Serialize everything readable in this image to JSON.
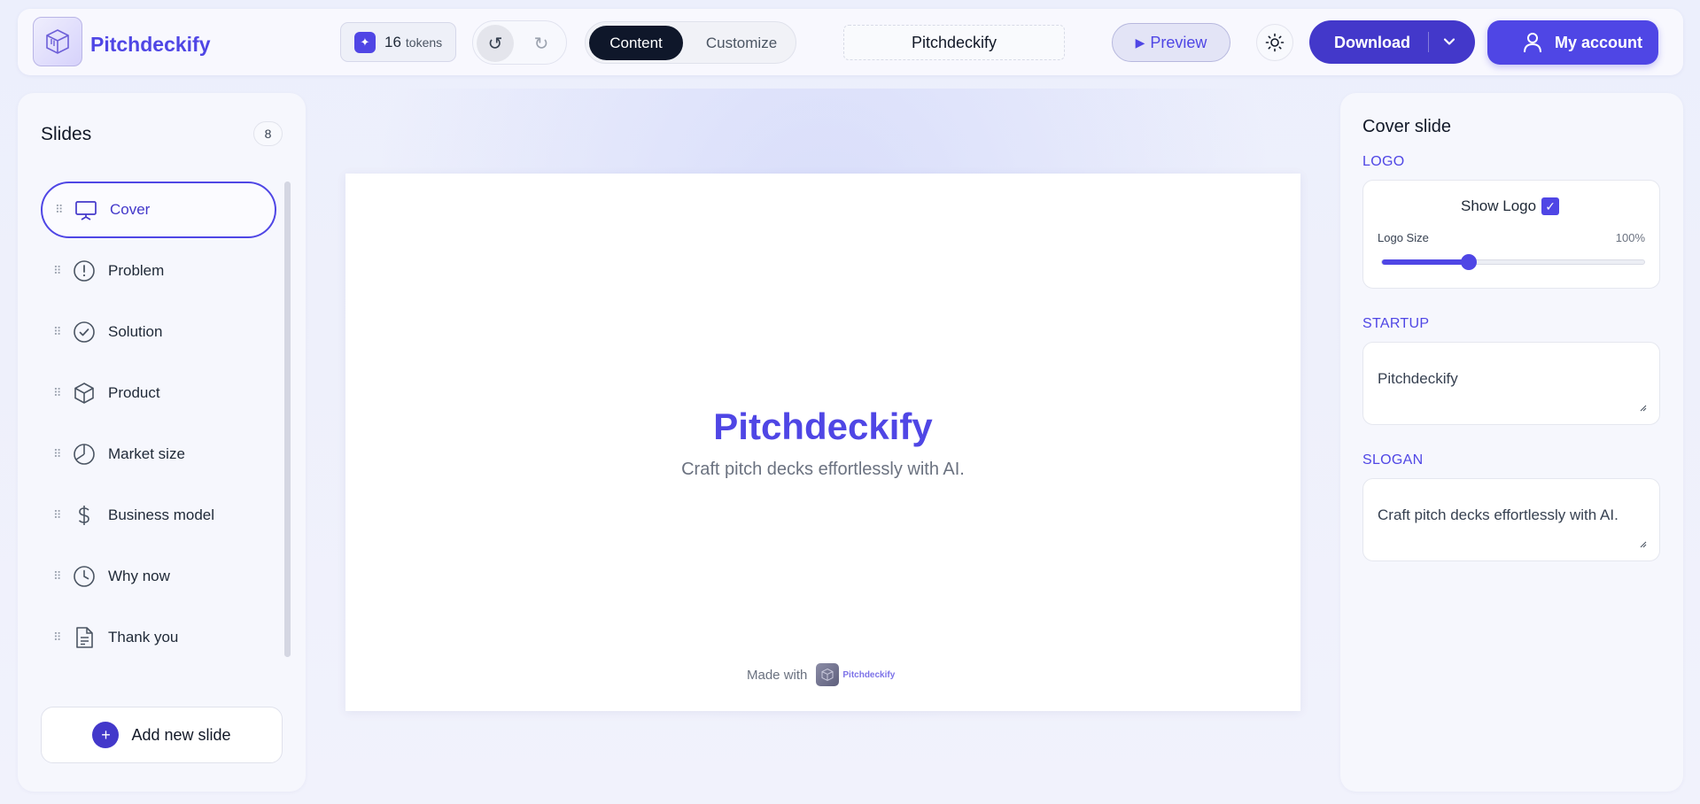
{
  "header": {
    "brand": "Pitchdeckify",
    "tokens": {
      "count": "16",
      "unit": "tokens"
    },
    "tabs": {
      "content": "Content",
      "customize": "Customize"
    },
    "deck_title": "Pitchdeckify",
    "preview_label": "Preview",
    "download_label": "Download",
    "account_label": "My account"
  },
  "sidebar": {
    "title": "Slides",
    "count": "8",
    "items": [
      {
        "label": "Cover",
        "icon": "presentation-icon",
        "active": true
      },
      {
        "label": "Problem",
        "icon": "alert-circle-icon"
      },
      {
        "label": "Solution",
        "icon": "check-circle-icon"
      },
      {
        "label": "Product",
        "icon": "box-icon"
      },
      {
        "label": "Market size",
        "icon": "pie-chart-icon"
      },
      {
        "label": "Business model",
        "icon": "dollar-icon"
      },
      {
        "label": "Why now",
        "icon": "clock-icon"
      },
      {
        "label": "Thank you",
        "icon": "document-icon"
      }
    ],
    "add_label": "Add new slide"
  },
  "canvas": {
    "title": "Pitchdeckify",
    "slogan": "Craft pitch decks effortlessly with AI.",
    "footer_made_with": "Made with",
    "footer_brand": "Pitchdeckify"
  },
  "panel": {
    "title": "Cover slide",
    "logo_section": "LOGO",
    "show_logo_label": "Show Logo",
    "show_logo_checked": true,
    "logo_size_label": "Logo Size",
    "logo_size_value": "100%",
    "logo_size_fraction": 0.33,
    "startup_section": "STARTUP",
    "startup_value": "Pitchdeckify",
    "slogan_section": "SLOGAN",
    "slogan_value": "Craft pitch decks effortlessly with AI."
  },
  "colors": {
    "accent": "#4f46e5",
    "accent_dark": "#4338ca",
    "dark_tab": "#0f172a"
  }
}
